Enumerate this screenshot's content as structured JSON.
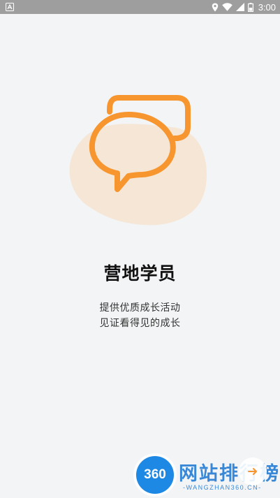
{
  "status_bar": {
    "time": "3:00",
    "icons": [
      "app-notification-icon",
      "location-icon",
      "wifi-icon",
      "signal-icon",
      "battery-icon"
    ]
  },
  "colors": {
    "accent": "#f7952e",
    "blob": "#f6e6d6",
    "background": "#f3f4f6",
    "status_bar": "#9e9e9e"
  },
  "illustration": {
    "icon": "chat-bubbles-icon"
  },
  "main": {
    "title": "营地学员",
    "description_line1": "提供优质成长活动",
    "description_line2": "见证看得见的成长"
  },
  "watermark": {
    "logo_text": "360",
    "title": "网站排行榜",
    "subtitle": "-WANGZHAN360.CN-"
  }
}
